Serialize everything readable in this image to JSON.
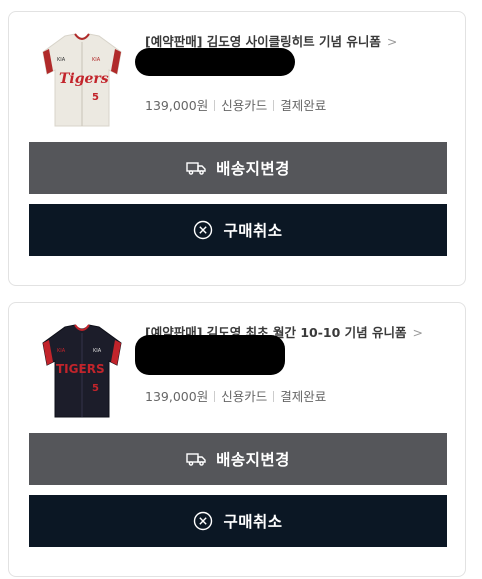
{
  "orders": [
    {
      "title": "[예약판매] 김도영 사이클링히트 기념 유니폼",
      "chevron": ">",
      "price": "139,000원",
      "payment": "신용카드",
      "status": "결제완료",
      "jersey": {
        "style": "home",
        "team_text": "Tigers",
        "number": "5",
        "sponsor": "KIA"
      },
      "change_address_label": "배송지변경",
      "cancel_label": "구매취소"
    },
    {
      "title": "[예약판매] 김도영 최초 월간 10-10 기념 유니폼",
      "chevron": ">",
      "price": "139,000원",
      "payment": "신용카드",
      "status": "결제완료",
      "jersey": {
        "style": "away",
        "team_text": "TIGERS",
        "number": "5",
        "sponsor": "KIA"
      },
      "change_address_label": "배송지변경",
      "cancel_label": "구매취소"
    }
  ],
  "colors": {
    "change_button_bg": "#55565a",
    "cancel_button_bg": "#0b1724",
    "card_border": "#e2e2e2"
  },
  "icons": {
    "change_address": "truck-icon",
    "cancel": "circle-x-icon"
  }
}
